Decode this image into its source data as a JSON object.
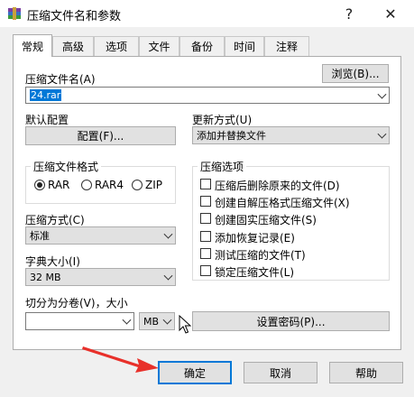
{
  "window": {
    "title": "压缩文件名和参数",
    "help_glyph": "?",
    "close_glyph": "✕"
  },
  "tabs": [
    "常规",
    "高级",
    "选项",
    "文件",
    "备份",
    "时间",
    "注释"
  ],
  "archive": {
    "label": "压缩文件名(A)",
    "value": "24.rar",
    "browse_label": "浏览(B)..."
  },
  "profile": {
    "label": "默认配置",
    "button_label": "配置(F)..."
  },
  "update": {
    "label": "更新方式(U)",
    "value": "添加并替换文件"
  },
  "format": {
    "group_title": "压缩文件格式",
    "options": [
      "RAR",
      "RAR4",
      "ZIP"
    ],
    "selected": "RAR"
  },
  "options_group": {
    "title": "压缩选项",
    "items": [
      "压缩后删除原来的文件(D)",
      "创建自解压格式压缩文件(X)",
      "创建固实压缩文件(S)",
      "添加恢复记录(E)",
      "测试压缩的文件(T)",
      "锁定压缩文件(L)"
    ]
  },
  "method": {
    "label": "压缩方式(C)",
    "value": "标准"
  },
  "dictionary": {
    "label": "字典大小(I)",
    "value": "32 MB"
  },
  "split": {
    "label": "切分为分卷(V)，大小",
    "value": "",
    "unit": "MB"
  },
  "password_button": "设置密码(P)...",
  "footer": {
    "ok": "确定",
    "cancel": "取消",
    "help": "帮助"
  },
  "colors": {
    "accent": "#0078d7",
    "arrow": "#e8302a"
  }
}
